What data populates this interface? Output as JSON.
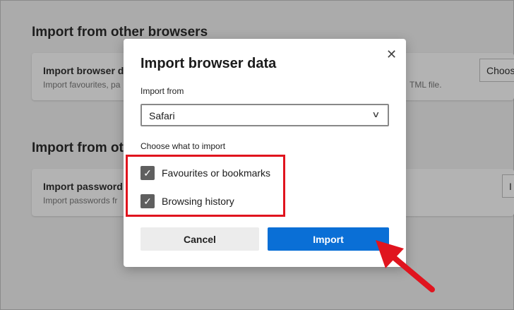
{
  "background": {
    "heading1": "Import from other browsers",
    "card1": {
      "title": "Import browser d",
      "subtitle": "Import favourites, pa",
      "subtitle_right": "TML file.",
      "button": "Choos"
    },
    "heading2": "Import from ot",
    "card2": {
      "title": "Import password",
      "subtitle": "Import passwords fr",
      "button": "I"
    }
  },
  "dialog": {
    "title": "Import browser data",
    "import_from_label": "Import from",
    "import_from_value": "Safari",
    "choose_label": "Choose what to import",
    "options": [
      {
        "label": "Favourites or bookmarks",
        "checked": true
      },
      {
        "label": "Browsing history",
        "checked": true
      }
    ],
    "cancel": "Cancel",
    "import": "Import",
    "close_glyph": "✕",
    "check_glyph": "✓",
    "chevron_glyph": "∨"
  },
  "colors": {
    "accent": "#0a6fd6",
    "highlight": "#e0141e"
  }
}
